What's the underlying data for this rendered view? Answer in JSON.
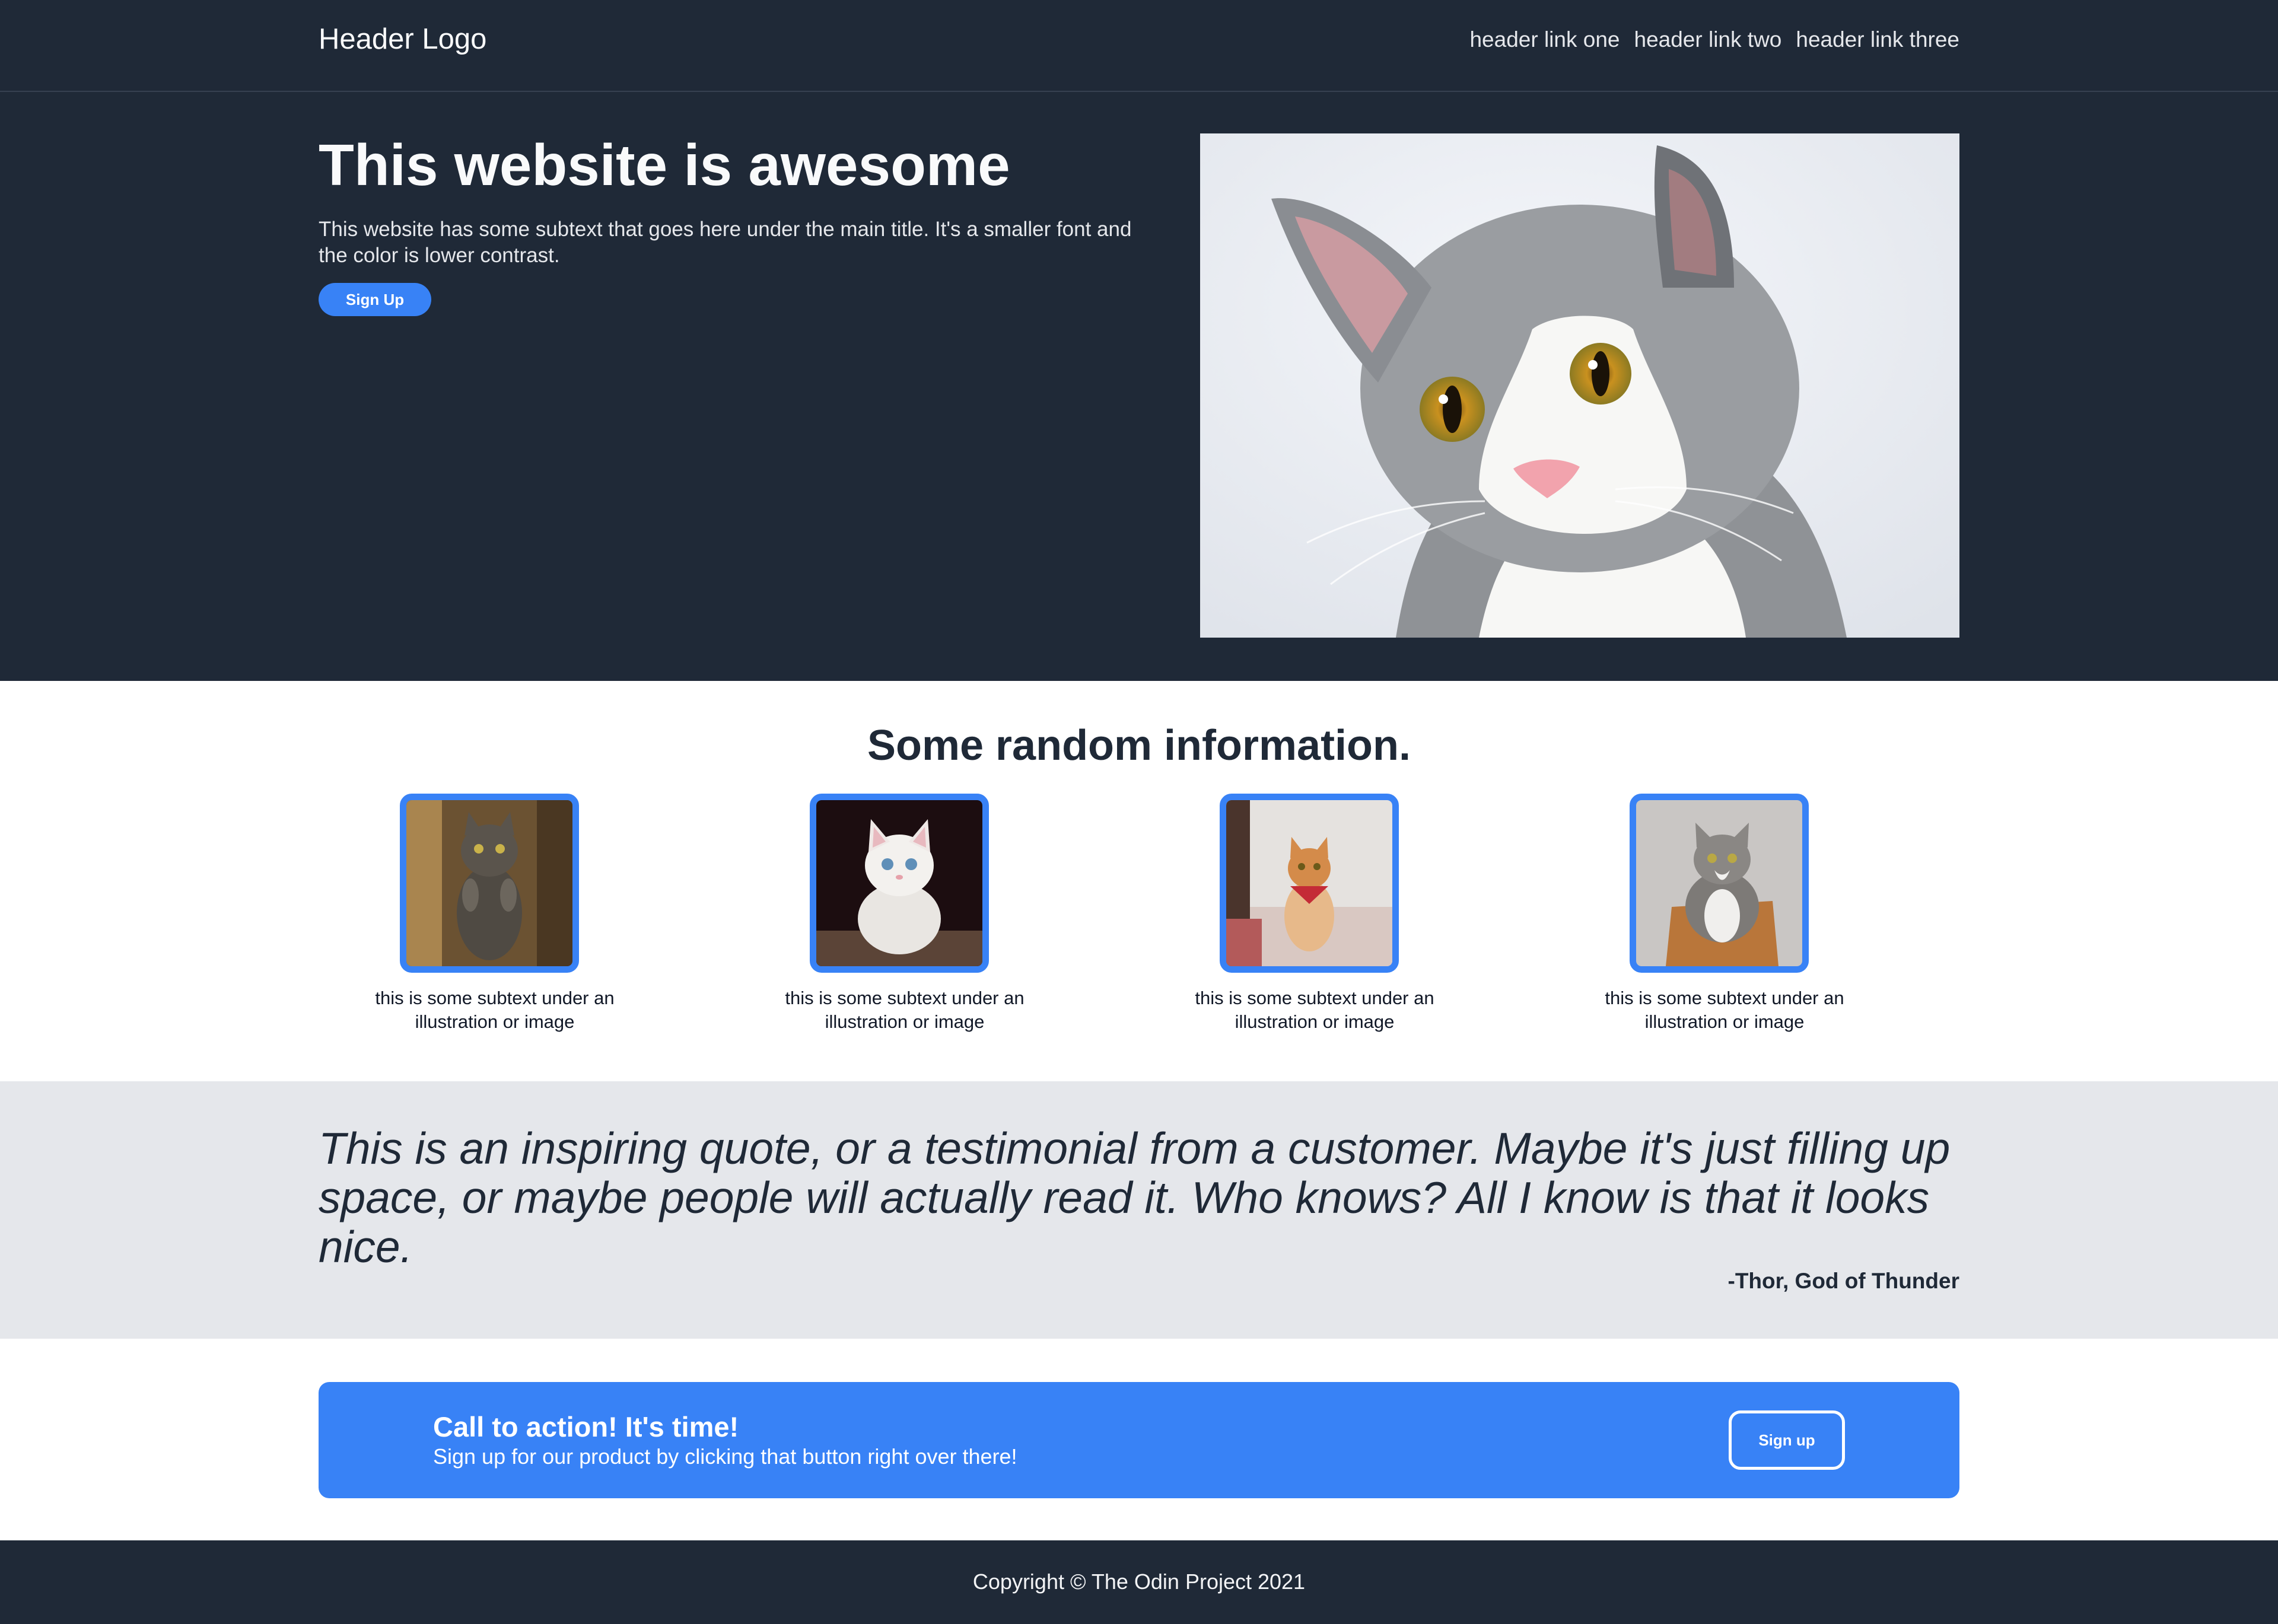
{
  "header": {
    "logo": "Header Logo",
    "links": [
      "header link one",
      "header link two",
      "header link three"
    ]
  },
  "hero": {
    "title": "This website is awesome",
    "subtext": "This website has some subtext that goes here under the main title. It's a smaller font and the color is lower contrast.",
    "button_label": "Sign Up",
    "image_icon": "cat-photo"
  },
  "info": {
    "title": "Some random information.",
    "cards": [
      {
        "icon": "cat-standing-photo",
        "text": "this is some subtext under an illustration or image"
      },
      {
        "icon": "white-kitten-photo",
        "text": "this is some subtext under an illustration or image"
      },
      {
        "icon": "ginger-cat-bandana-photo",
        "text": "this is some subtext under an illustration or image"
      },
      {
        "icon": "grey-cat-basket-photo",
        "text": "this is some subtext under an illustration or image"
      }
    ]
  },
  "quote": {
    "text": "This is an inspiring quote, or a testimonial from a customer. Maybe it's just filling up space, or maybe people will actually read it. Who knows? All I know is that it looks nice.",
    "author": "-Thor, God of Thunder"
  },
  "cta": {
    "title": "Call to action! It's time!",
    "text": "Sign up for our product by clicking that button right over there!",
    "button_label": "Sign up"
  },
  "footer": {
    "text": "Copyright © The Odin Project 2021"
  },
  "colors": {
    "dark_bg": "#1f2937",
    "accent_blue": "#3882f6",
    "light_gray": "#e5e7eb"
  }
}
